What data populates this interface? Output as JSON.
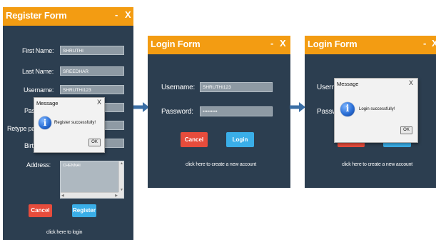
{
  "register": {
    "title": "Register Form",
    "min": "-",
    "close": "X",
    "labels": {
      "first_name": "First Name:",
      "last_name": "Last Name:",
      "username": "Username:",
      "password": "Pas",
      "retype": "Retype pas",
      "birth": "Birt",
      "address": "Address:"
    },
    "values": {
      "first_name": "SHRUTHI",
      "last_name": "SREEDHAR",
      "username": "SHRUTHI123",
      "address": "CHENNAI"
    },
    "cancel": "Cancel",
    "submit": "Register",
    "link": "click here to login"
  },
  "register_dialog": {
    "title": "Message",
    "close": "X",
    "icon": "info-icon",
    "message": "Register successfully!",
    "ok": "OK"
  },
  "login": {
    "title": "Login Form",
    "min": "-",
    "close": "X",
    "username_label": "Username:",
    "username_value": "SHRUTHI123",
    "password_label": "Password:",
    "password_value": "•••••••••",
    "cancel": "Cancel",
    "submit": "Login",
    "link": "click here to create a new account"
  },
  "login2": {
    "title": "Login Form",
    "min": "-",
    "close": "X",
    "username_label": "Userna",
    "password_label": "Passw",
    "link": "click here to create a new account"
  },
  "login_dialog": {
    "title": "Message",
    "close": "X",
    "icon": "info-icon",
    "message": "Login successfully!",
    "ok": "OK"
  },
  "colors": {
    "panel": "#2c3e50",
    "titlebar": "#f39c12",
    "cancel": "#e74c3c",
    "primary": "#3aaee8",
    "arrow": "#3a6ea5"
  }
}
